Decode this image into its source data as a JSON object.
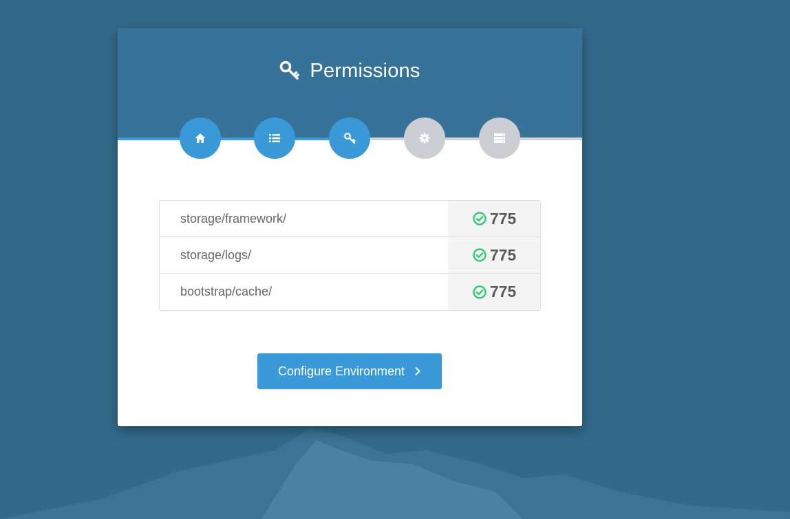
{
  "colors": {
    "background": "#336a8a",
    "header": "#377299",
    "accent": "#3a9ad9",
    "inactive_step": "#cbcfd3",
    "success": "#2ecc71"
  },
  "header": {
    "title": "Permissions",
    "icon": "key-icon"
  },
  "steps": [
    {
      "name": "welcome",
      "icon": "home-icon",
      "state": "complete"
    },
    {
      "name": "requirements",
      "icon": "list-icon",
      "state": "complete"
    },
    {
      "name": "permissions",
      "icon": "key-icon",
      "state": "current"
    },
    {
      "name": "environment",
      "icon": "gear-icon",
      "state": "pending"
    },
    {
      "name": "database",
      "icon": "server-icon",
      "state": "pending"
    }
  ],
  "permissions": [
    {
      "path": "storage/framework/",
      "value": "775",
      "status": "ok"
    },
    {
      "path": "storage/logs/",
      "value": "775",
      "status": "ok"
    },
    {
      "path": "bootstrap/cache/",
      "value": "775",
      "status": "ok"
    }
  ],
  "actions": {
    "next_label": "Configure Environment"
  }
}
